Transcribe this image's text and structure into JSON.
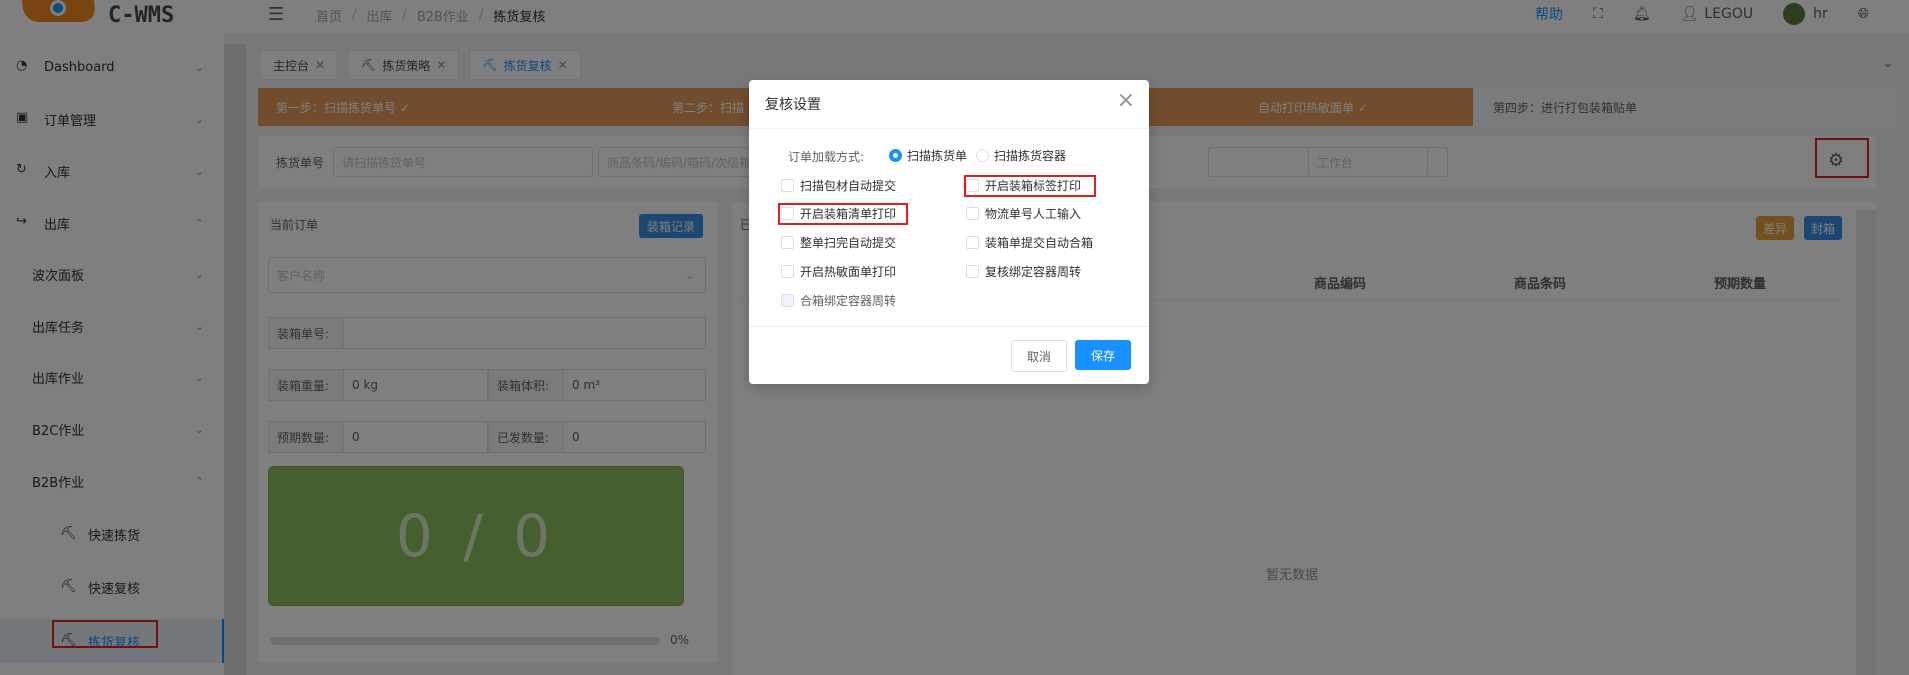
{
  "app": {
    "logo_text": "C-WMS"
  },
  "breadcrumb": [
    "首页",
    "出库",
    "B2B作业",
    "拣货复核"
  ],
  "header": {
    "help": "帮助",
    "user": "LEGOU",
    "lang_user": "hr"
  },
  "sidebar": {
    "items": [
      {
        "label": "Dashboard",
        "icon": "dashboard-icon"
      },
      {
        "label": "订单管理",
        "icon": "order-icon"
      },
      {
        "label": "入库",
        "icon": "inbound-icon"
      },
      {
        "label": "出库",
        "icon": "outbound-icon"
      }
    ],
    "sub_items": [
      "波次面板",
      "出库任务",
      "出库作业",
      "B2C作业",
      "B2B作业"
    ],
    "b2b_items": [
      "快速拣货",
      "快速复核",
      "拣货复核"
    ]
  },
  "tabs": [
    {
      "label": "主控台"
    },
    {
      "label": "拣货策略"
    },
    {
      "label": "拣货复核"
    }
  ],
  "steps": [
    "第一步：扫描拣货单号 ✓",
    "第二步：扫描",
    "自动打印热敏面单 ✓",
    "第四步：进行打包装箱贴单"
  ],
  "search": {
    "label": "拣货单号",
    "placeholder": "请扫描拣货单号",
    "placeholder2": "商品条码/编码/箱码/次级箱",
    "placeholder3": "工作台"
  },
  "left_panel": {
    "title": "当前订单",
    "record_btn": "装箱记录",
    "customer_placeholder": "客户名称",
    "box_no_label": "装箱单号:",
    "weight_label": "装箱重量:",
    "weight_value": "0 kg",
    "volume_label": "装箱体积:",
    "volume_value": "0 m³",
    "expected_label": "预期数量:",
    "expected_value": "0",
    "shipped_label": "已发数量:",
    "shipped_value": "0",
    "counter": "0 / 0",
    "progress": "0%"
  },
  "right_panel": {
    "title_char": "已",
    "diff_btn": "差异",
    "seal_btn": "封箱",
    "columns": [
      "商品编码",
      "商品条码",
      "预期数量"
    ],
    "empty": "暂无数据"
  },
  "modal": {
    "title": "复核设置",
    "load_label": "订单加载方式:",
    "radio1": "扫描拣货单",
    "radio2": "扫描拣货容器",
    "checks": [
      "扫描包材自动提交",
      "开启装箱标签打印",
      "开启装箱清单打印",
      "物流单号人工输入",
      "整单扫完自动提交",
      "装箱单提交自动合箱",
      "开启热敏面单打印",
      "复核绑定容器周转",
      "合箱绑定容器周转"
    ],
    "cancel": "取消",
    "save": "保存"
  },
  "colors": {
    "primary": "#1890ff",
    "step_bg": "#e39b5c",
    "counter_bg": "#8bbf5c",
    "highlight": "#e02020"
  }
}
